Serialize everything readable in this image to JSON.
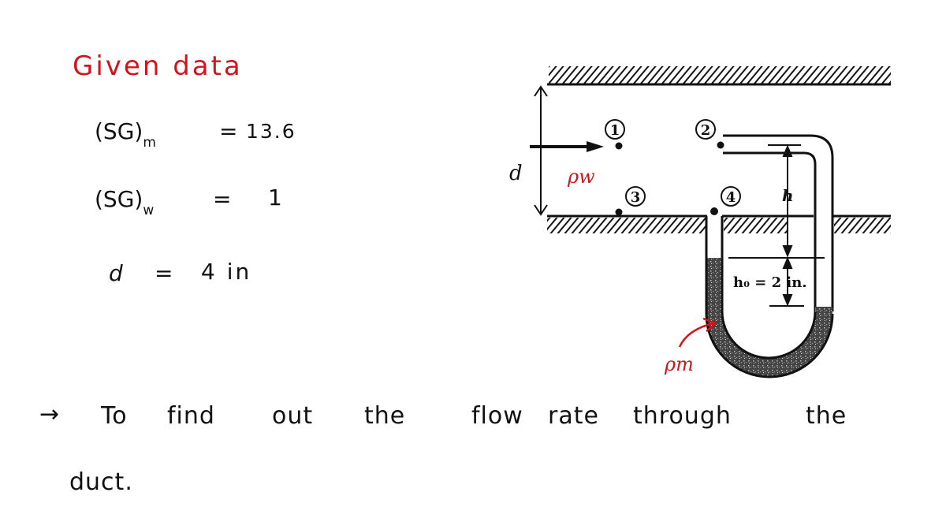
{
  "heading": "Given data",
  "given": [
    {
      "lhs": "(SG)",
      "sub": "m",
      "eq": "=",
      "rhs": "13.6"
    },
    {
      "lhs": "(SG)",
      "sub": "w",
      "eq": "=",
      "rhs": "1"
    },
    {
      "lhs": "d",
      "sub": "",
      "eq": "=",
      "rhs": "4 in"
    }
  ],
  "objective": {
    "arrow": "→",
    "words": [
      "To",
      "find",
      "out",
      "the",
      "flow",
      "rate",
      "through",
      "the"
    ],
    "line2": "duct."
  },
  "diagram": {
    "point_labels": [
      "1",
      "2",
      "3",
      "4"
    ],
    "dimension_d": "d",
    "density_water": "ρw",
    "density_manometer": "ρm",
    "h_label": "h",
    "h0_label": "h₀ = 2 in.",
    "colors": {
      "annotation": "#d4141c",
      "ink": "#111111",
      "fluid": "#555555"
    }
  }
}
